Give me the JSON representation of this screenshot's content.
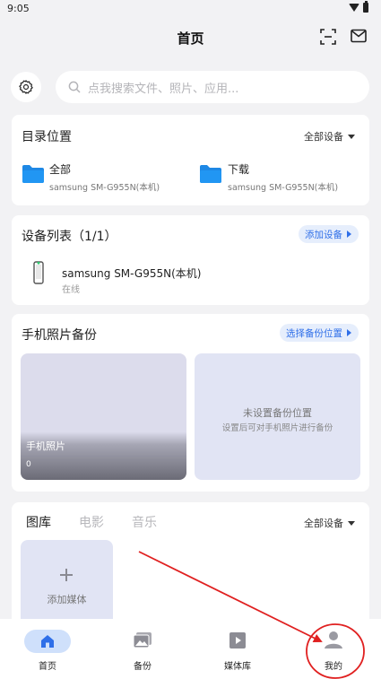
{
  "status_bar": {
    "time": "9:05"
  },
  "header": {
    "title": "首页"
  },
  "search": {
    "placeholder": "点我搜索文件、照片、应用..."
  },
  "directory": {
    "title": "目录位置",
    "filter": "全部设备",
    "folders": [
      {
        "name": "全部",
        "device": "samsung SM-G955N(本机)"
      },
      {
        "name": "下载",
        "device": "samsung SM-G955N(本机)"
      }
    ]
  },
  "devices": {
    "title": "设备列表（1/1）",
    "add_label": "添加设备",
    "items": [
      {
        "name": "samsung SM-G955N(本机)",
        "status": "在线"
      }
    ]
  },
  "photo_backup": {
    "title": "手机照片备份",
    "select_label": "选择备份位置",
    "album": {
      "label": "手机照片",
      "count": "0"
    },
    "unset": {
      "title": "未设置备份位置",
      "subtitle": "设置后可对手机照片进行备份"
    }
  },
  "media": {
    "tabs": [
      {
        "label": "图库"
      },
      {
        "label": "电影"
      },
      {
        "label": "音乐"
      }
    ],
    "filter": "全部设备",
    "add_label": "添加媒体"
  },
  "bottom_nav": {
    "items": [
      {
        "label": "首页",
        "icon": "home-icon",
        "active": true
      },
      {
        "label": "备份",
        "icon": "photo-backup-icon"
      },
      {
        "label": "媒体库",
        "icon": "media-library-icon"
      },
      {
        "label": "我的",
        "icon": "person-icon"
      }
    ]
  },
  "colors": {
    "accent": "#2f6fe8",
    "folder_blue": "#1e88e5",
    "annotation_red": "#e02020",
    "page_bg": "#f2f2f4"
  }
}
